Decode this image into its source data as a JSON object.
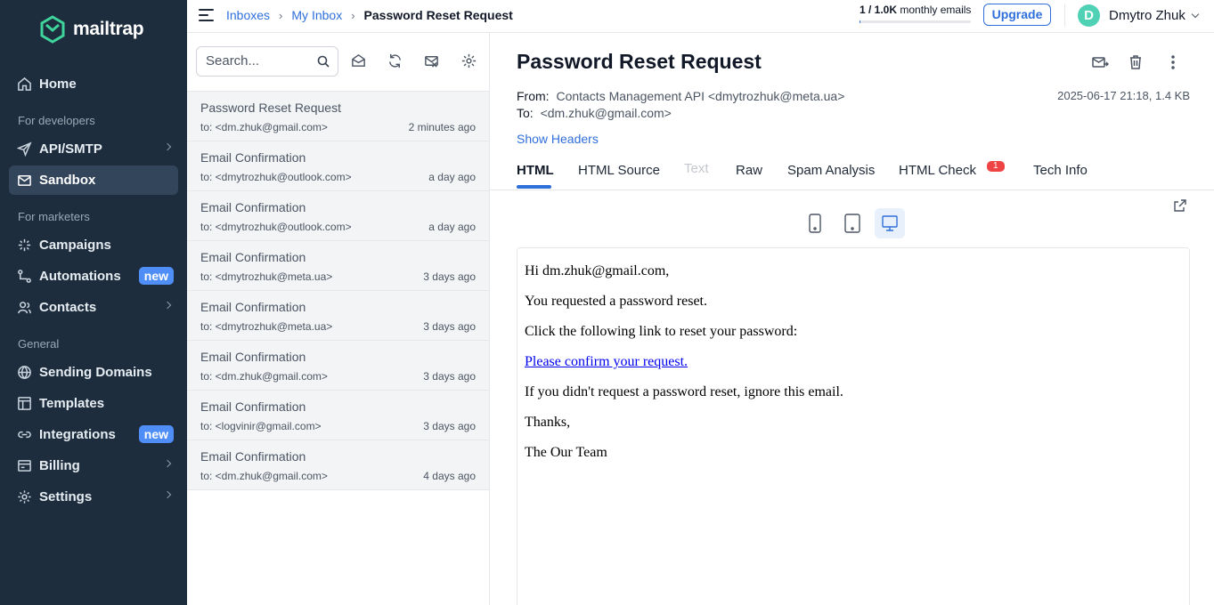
{
  "brand": {
    "name": "mailtrap"
  },
  "sidebar": {
    "items": [
      {
        "label": "Home",
        "icon": "home-icon"
      },
      {
        "label": "API/SMTP",
        "icon": "send-icon"
      },
      {
        "label": "Sandbox",
        "icon": "sandbox-icon"
      },
      {
        "label": "Campaigns",
        "icon": "sparkle-icon"
      },
      {
        "label": "Automations",
        "icon": "automation-icon",
        "badge": "new"
      },
      {
        "label": "Contacts",
        "icon": "contacts-icon"
      },
      {
        "label": "Sending Domains",
        "icon": "globe-icon"
      },
      {
        "label": "Templates",
        "icon": "template-icon"
      },
      {
        "label": "Integrations",
        "icon": "link-icon",
        "badge": "new"
      },
      {
        "label": "Billing",
        "icon": "billing-icon"
      },
      {
        "label": "Settings",
        "icon": "gear-icon"
      }
    ],
    "sections": [
      "For developers",
      "For marketers",
      "General"
    ]
  },
  "breadcrumb": {
    "inboxes": "Inboxes",
    "my_inbox": "My Inbox",
    "current": "Password Reset Request"
  },
  "quota": {
    "used": "1 / 1.0K",
    "suffix": "monthly emails",
    "fraction": 0.001
  },
  "header": {
    "upgrade": "Upgrade",
    "user_initial": "D",
    "user_name": "Dmytro Zhuk"
  },
  "list": {
    "search_placeholder": "Search...",
    "messages": [
      {
        "subject": "Password Reset Request",
        "to": "to: <dm.zhuk@gmail.com>",
        "time": "2 minutes ago"
      },
      {
        "subject": "Email Confirmation",
        "to": "to: <dmytrozhuk@outlook.com>",
        "time": "a day ago"
      },
      {
        "subject": "Email Confirmation",
        "to": "to: <dmytrozhuk@outlook.com>",
        "time": "a day ago"
      },
      {
        "subject": "Email Confirmation",
        "to": "to: <dmytrozhuk@meta.ua>",
        "time": "3 days ago"
      },
      {
        "subject": "Email Confirmation",
        "to": "to: <dmytrozhuk@meta.ua>",
        "time": "3 days ago"
      },
      {
        "subject": "Email Confirmation",
        "to": "to: <dm.zhuk@gmail.com>",
        "time": "3 days ago"
      },
      {
        "subject": "Email Confirmation",
        "to": "to: <logvinir@gmail.com>",
        "time": "3 days ago"
      },
      {
        "subject": "Email Confirmation",
        "to": "to: <dm.zhuk@gmail.com>",
        "time": "4 days ago"
      }
    ]
  },
  "message": {
    "title": "Password Reset Request",
    "from_label": "From:",
    "from": "Contacts Management API <dmytrozhuk@meta.ua>",
    "to_label": "To:",
    "to": "<dm.zhuk@gmail.com>",
    "meta": "2025-06-17 21:18, 1.4 KB",
    "show_headers": "Show Headers",
    "tabs": [
      "HTML",
      "HTML Source",
      "Text",
      "Raw",
      "Spam Analysis",
      "HTML Check",
      "Tech Info"
    ],
    "html_check_badge": "1",
    "body": {
      "greeting": "Hi dm.zhuk@gmail.com,",
      "line1": "You requested a password reset.",
      "line2": "Click the following link to reset your password:",
      "link": "Please confirm your request.",
      "line3": "If you didn't request a password reset, ignore this email.",
      "thanks": "Thanks,",
      "signature": "The Our Team"
    }
  },
  "colors": {
    "sidebar_bg": "#1e2d3d",
    "accent": "#2f6fdb",
    "badge_new": "#4f8ef7",
    "alert": "#ef4444"
  }
}
